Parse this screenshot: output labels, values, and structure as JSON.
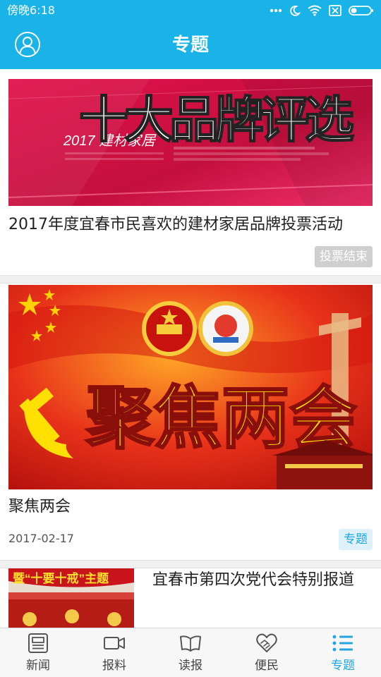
{
  "status_bar": {
    "time": "傍晚6:18"
  },
  "header": {
    "title": "专题",
    "avatar_icon": "user-avatar-icon"
  },
  "cards": [
    {
      "banner_text_main": "十大品牌评选",
      "banner_text_sub": "2017 建材家居",
      "title": "2017年度宜春市民喜欢的建材家居品牌投票活动",
      "tag": "投票结束"
    },
    {
      "banner_text": "聚焦两会",
      "title": "聚焦两会",
      "date": "2017-02-17",
      "tag": "专题"
    },
    {
      "thumb_text": "暨“十要十戒”主题",
      "title": "宜春市第四次党代会特别报道"
    }
  ],
  "tabbar": {
    "items": [
      {
        "label": "新闻",
        "icon": "news-icon"
      },
      {
        "label": "报料",
        "icon": "video-camera-icon"
      },
      {
        "label": "读报",
        "icon": "open-book-icon"
      },
      {
        "label": "便民",
        "icon": "handshake-heart-icon"
      },
      {
        "label": "专题",
        "icon": "list-icon"
      }
    ],
    "active_index": 4
  },
  "colors": {
    "accent": "#1ab3e8",
    "active_tab": "#21a6df"
  }
}
